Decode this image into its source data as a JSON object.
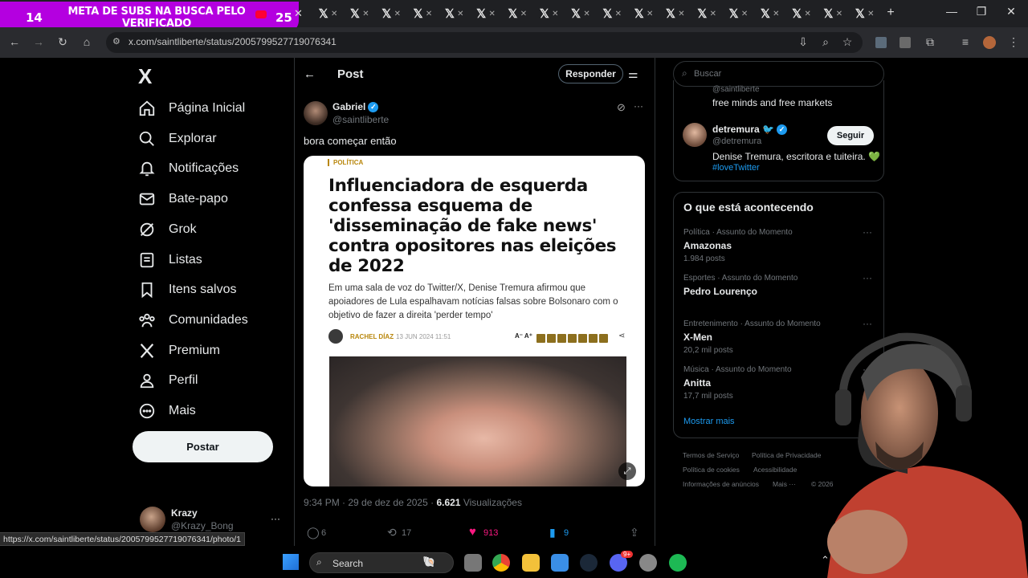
{
  "overlay": {
    "left_number": "14",
    "banner_text": "META DE SUBS NA BUSCA PELO VERIFICADO",
    "right_number": "25"
  },
  "browser": {
    "url": "x.com/saintliberte/status/2005799527719076341",
    "status_url": "https://x.com/saintliberte/status/2005799527719076341/photo/1",
    "tab_count": 18
  },
  "nav": {
    "logo": "X",
    "items": [
      {
        "label": "Página Inicial",
        "icon": "home-icon"
      },
      {
        "label": "Explorar",
        "icon": "search-icon"
      },
      {
        "label": "Notificações",
        "icon": "bell-icon"
      },
      {
        "label": "Bate-papo",
        "icon": "mail-icon"
      },
      {
        "label": "Grok",
        "icon": "grok-icon"
      },
      {
        "label": "Listas",
        "icon": "list-icon"
      },
      {
        "label": "Itens salvos",
        "icon": "bookmark-icon"
      },
      {
        "label": "Comunidades",
        "icon": "community-icon"
      },
      {
        "label": "Premium",
        "icon": "x-premium-icon"
      },
      {
        "label": "Perfil",
        "icon": "person-icon"
      },
      {
        "label": "Mais",
        "icon": "more-circle-icon"
      }
    ],
    "post_button": "Postar",
    "account": {
      "name": "Krazy",
      "handle": "@Krazy_Bong",
      "more": "···"
    }
  },
  "post": {
    "header_title": "Post",
    "reply_button": "Responder",
    "author_name": "Gabriel",
    "author_handle": "@saintliberte",
    "text": "bora começar então",
    "time": "9:34 PM · 29 de dez de 2025 ·",
    "views_count": "6.621",
    "views_label": "Visualizações",
    "stats": {
      "replies": "6",
      "reposts": "17",
      "likes": "913",
      "bookmarks": "9"
    }
  },
  "article": {
    "section": "POLÍTICA",
    "headline": "Influenciadora de esquerda confessa esquema de 'disseminação de fake news' contra opositores nas eleições de 2022",
    "dek": "Em uma sala de voz do Twitter/X, Denise Tremura afirmou que apoiadores de Lula espalhavam notícias falsas sobre Bolsonaro com o objetivo de fazer a direita 'perder tempo'",
    "author": "RACHEL DÍAZ",
    "date": "13 JUN 2024 11:51",
    "font_controls": "A⁻ A⁺"
  },
  "right": {
    "search_placeholder": "Buscar",
    "partial_handle": "@saintliberte",
    "partial_bio": "free minds and free markets",
    "suggest": {
      "name": "detremura",
      "handle": "@detremura",
      "bio": "Denise Tremura, escritora e tuiteira. 💚",
      "hashtag": "#loveTwitter",
      "follow": "Seguir"
    },
    "trends_title": "O que está acontecendo",
    "trends": [
      {
        "category": "Política · Assunto do Momento",
        "name": "Amazonas",
        "count": "1.984 posts"
      },
      {
        "category": "Esportes · Assunto do Momento",
        "name": "Pedro Lourenço",
        "count": ""
      },
      {
        "category": "Entretenimento · Assunto do Momento",
        "name": "X-Men",
        "count": "20,2 mil posts"
      },
      {
        "category": "Música · Assunto do Momento",
        "name": "Anitta",
        "count": "17,7 mil posts"
      }
    ],
    "show_more": "Mostrar mais",
    "footer": [
      "Termos de Serviço",
      "Política de Privacidade",
      "Política de cookies",
      "Acessibilidade",
      "Informações de anúncios",
      "Mais ···",
      "© 2026"
    ]
  },
  "taskbar": {
    "search": "Search",
    "discord_badge": "9+"
  },
  "colors": {
    "x_blue": "#1d9bf0",
    "like_pink": "#f91880",
    "overlay_purple": "#b400e0",
    "gold": "#b8860b"
  }
}
